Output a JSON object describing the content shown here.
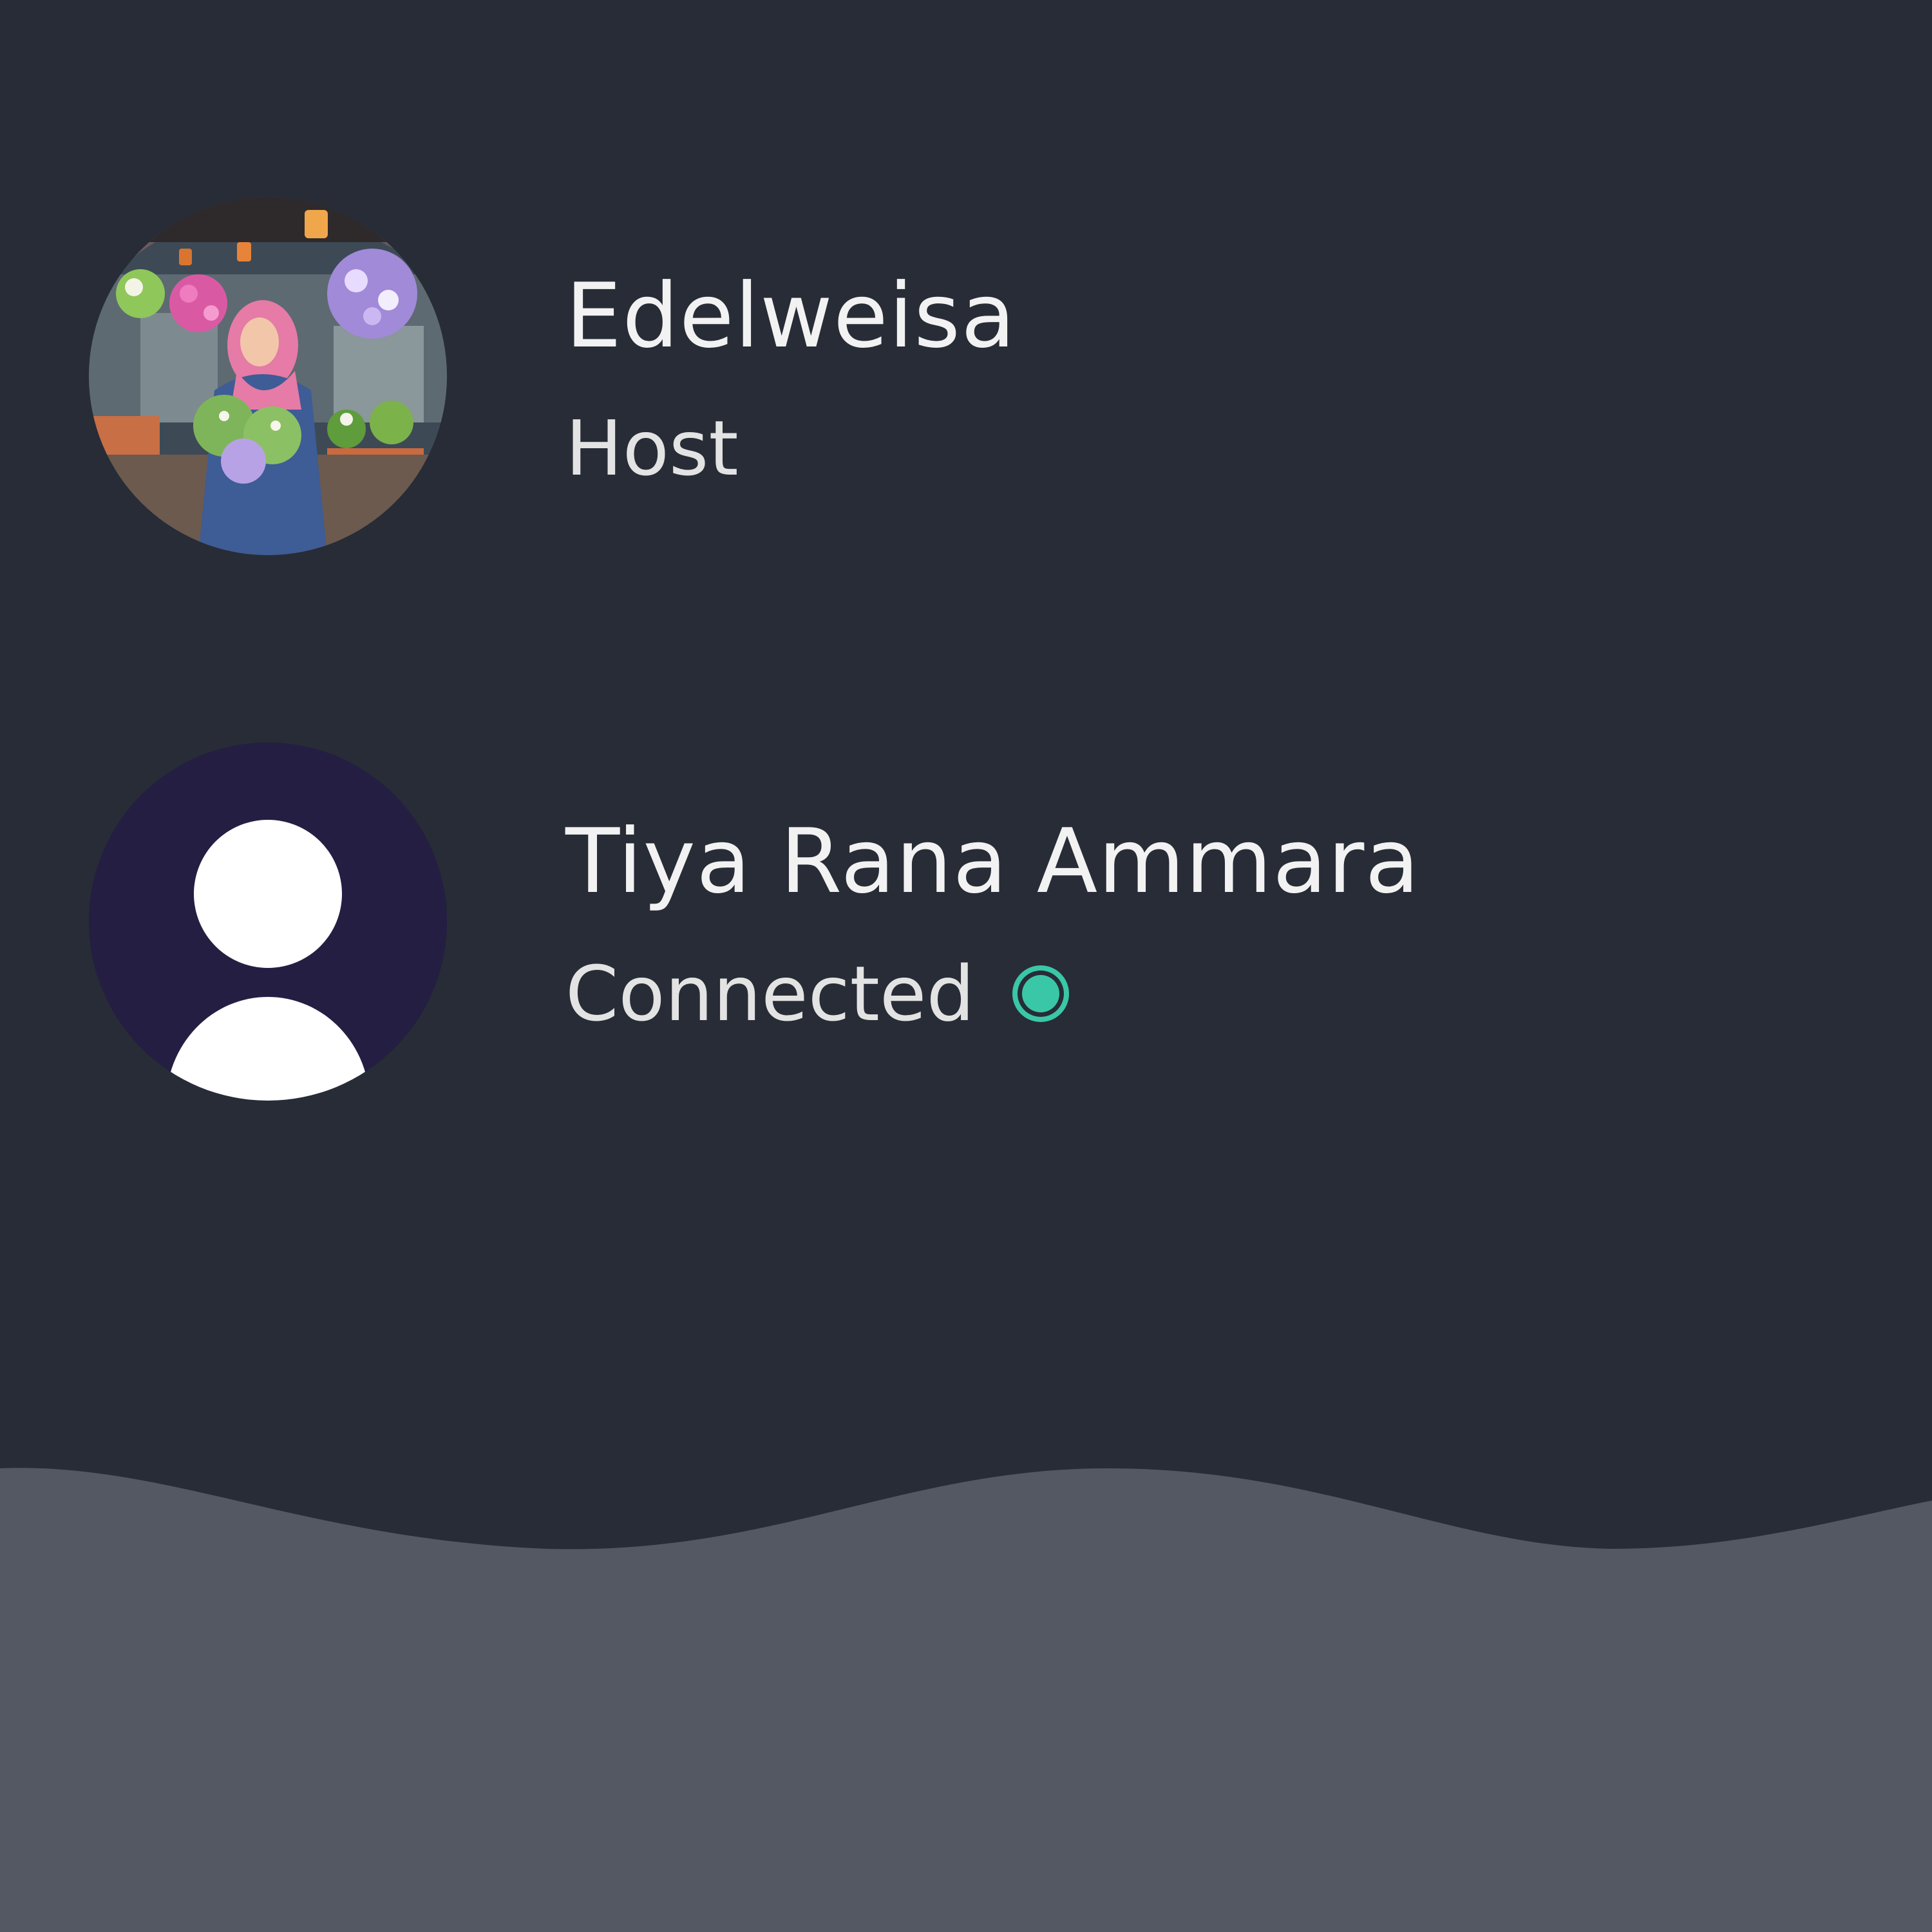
{
  "participants": [
    {
      "name": "Edelweisa",
      "role": "Host",
      "avatar": "photo"
    },
    {
      "name": "Tiya Rana Ammara",
      "status": "Connected",
      "status_icon": "connected-dot-icon",
      "avatar": "default-user-icon"
    }
  ],
  "colors": {
    "background": "#272c36",
    "footer_wave": "#545862",
    "avatar_placeholder_bg": "#241e43",
    "status_connected": "#3ac7a8",
    "text": "#f2f2f2"
  }
}
